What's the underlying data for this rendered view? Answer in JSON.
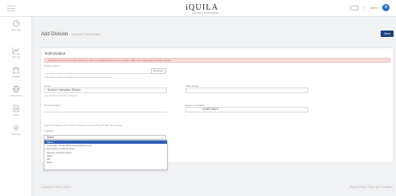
{
  "header": {
    "logo": "iQUILA",
    "logo_sub": "GRADED ENVIRONMENT",
    "user_name": "Admin",
    "user_initial": "A"
  },
  "sidebar": {
    "items": [
      {
        "icon": "dashboard-icon",
        "label": "Overview"
      },
      {
        "icon": "chart-icon",
        "label": "Reports"
      },
      {
        "icon": "building-icon",
        "label": "Entities"
      },
      {
        "icon": "globe-icon",
        "label": "Connections"
      },
      {
        "icon": "document-icon",
        "label": "Files"
      },
      {
        "icon": "settings-icon",
        "label": "Settings"
      }
    ]
  },
  "page": {
    "title": "Add Division",
    "breadcrumb": "Divisions / Add Division",
    "save_label": "Save"
  },
  "form": {
    "card_title": "Edit Division",
    "alert_text": "Please fix the errors below. Division name is required and must be unique within the organisation before saving.",
    "code_label": "Division Code",
    "generate_label": "Generate",
    "code_hint": "This code is used to identify the division across reports and exports.",
    "name_label": "Name",
    "name_value": "Northern Operations Division",
    "name_hint": "e.g. Northern Operations Division",
    "short_name_label": "Short Name",
    "short_name_value": "",
    "parent_label": "Parent Division",
    "parent_value": "",
    "region_label": "Region / Location",
    "region_value": "CORPORATE",
    "category_hint": "Select the category this division belongs to for reporting and filtering purposes.",
    "category_label": "Category",
    "category_selected": "Select",
    "category_options": [
      "Select",
      "Corporate / Head Office Administration Unit",
      "Operations / Field Services",
      "Finance and Accounting",
      "Sales",
      "HR",
      "Other"
    ]
  },
  "footer": {
    "left": "Copyright © 2023, iQUILA",
    "right": "Privacy Policy  |  Terms and Conditions"
  }
}
